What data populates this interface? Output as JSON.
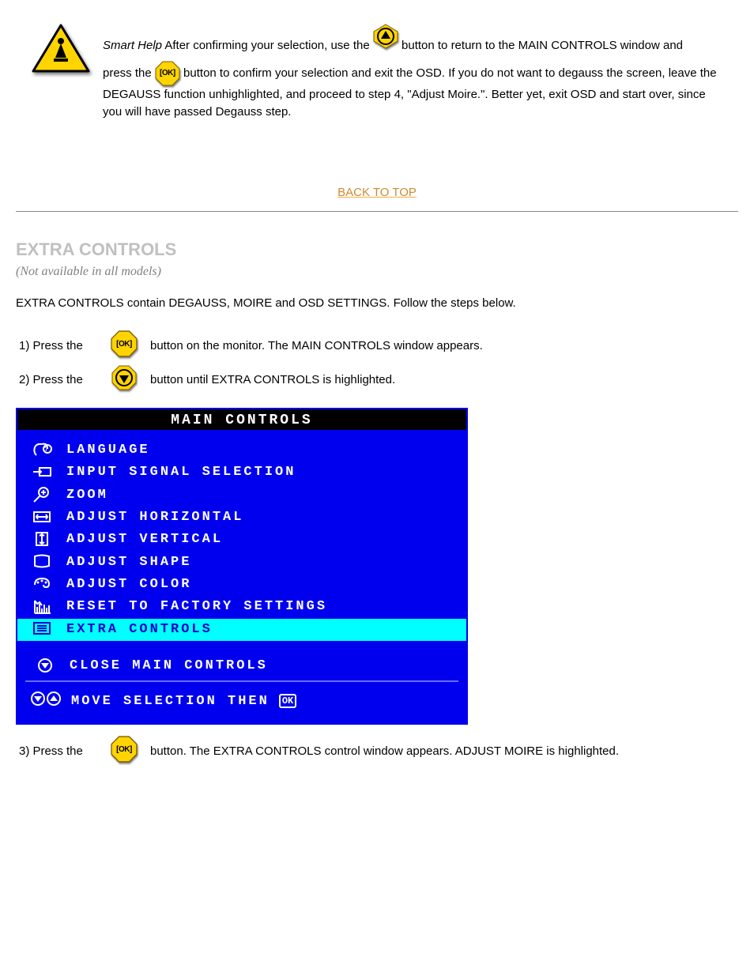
{
  "intro": {
    "p1_before": "After confirming your selection, use the ",
    "p1_after": " button to return to the MAIN CONTROLS window and",
    "p2_before_ok": "press the ",
    "p2_after_ok": " button to confirm your selection and exit the OSD. If you do not want to degauss the screen, leave the DEGAUSS function unhighlighted, and proceed to step 4, \"Adjust Moire.\". Better yet, exit OSD and start over, since you will have passed Degauss step.",
    "smart_help": "Smart Help",
    "back_top": "BACK TO TOP"
  },
  "section_title": "EXTRA CONTROLS",
  "section_sub": "(Not available in all models)",
  "section_lead": "EXTRA CONTROLS contain DEGAUSS, MOIRE and OSD SETTINGS. Follow the steps below.",
  "step1_num": "1) Press the ",
  "step1_after": " button on the monitor. The MAIN CONTROLS window appears.",
  "step2_num": "2) Press the ",
  "step2_after": " button until EXTRA CONTROLS is highlighted.",
  "osd": {
    "title": "MAIN CONTROLS",
    "items": [
      "LANGUAGE",
      "INPUT SIGNAL SELECTION",
      "ZOOM",
      "ADJUST HORIZONTAL",
      "ADJUST VERTICAL",
      "ADJUST SHAPE",
      "ADJUST COLOR",
      "RESET TO FACTORY SETTINGS",
      "EXTRA CONTROLS"
    ],
    "highlight_index": 8,
    "close": "CLOSE MAIN CONTROLS",
    "footer": "MOVE SELECTION THEN",
    "ok_glyph": "OK"
  },
  "step3_num": "3) Press the ",
  "step3_after": " button. The EXTRA CONTROLS control window appears. ADJUST MOIRE is highlighted.",
  "icons": {
    "ok": "ok-button",
    "up": "up-button",
    "down": "down-button",
    "warning": "warning-icon"
  }
}
